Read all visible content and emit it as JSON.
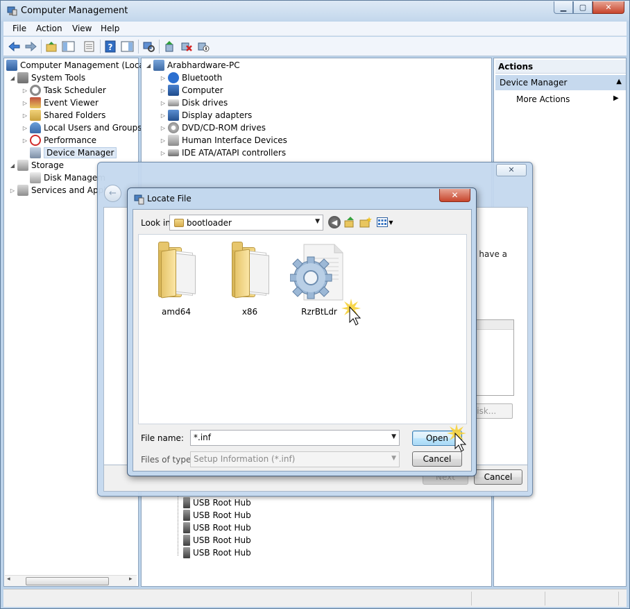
{
  "window": {
    "title": "Computer Management"
  },
  "menu": [
    "File",
    "Action",
    "View",
    "Help"
  ],
  "tree": {
    "root": "Computer Management (Local)",
    "items": [
      {
        "label": "System Tools"
      },
      {
        "label": "Task Scheduler"
      },
      {
        "label": "Event Viewer"
      },
      {
        "label": "Shared Folders"
      },
      {
        "label": "Local Users and Groups"
      },
      {
        "label": "Performance"
      },
      {
        "label": "Device Manager"
      },
      {
        "label": "Storage"
      },
      {
        "label": "Disk Managem"
      },
      {
        "label": "Services and Appl"
      }
    ]
  },
  "devices": {
    "computer": "Arabhardware-PC",
    "categories": [
      "Bluetooth",
      "Computer",
      "Disk drives",
      "Display adapters",
      "DVD/CD-ROM drives",
      "Human Interface Devices",
      "IDE ATA/ATAPI controllers"
    ],
    "usb_hubs": [
      "USB Root Hub",
      "USB Root Hub",
      "USB Root Hub",
      "USB Root Hub",
      "USB Root Hub"
    ]
  },
  "actions": {
    "header": "Actions",
    "section": "Device Manager",
    "more": "More Actions"
  },
  "wizard": {
    "close": "✕",
    "partial_text": "u have a",
    "disk_button": "Disk...",
    "next_button": "Next",
    "cancel_button": "Cancel"
  },
  "locate": {
    "title": "Locate File",
    "look_in_label": "Look in:",
    "look_in_value": "bootloader",
    "files": [
      {
        "name": "amd64",
        "type": "folder"
      },
      {
        "name": "x86",
        "type": "folder"
      },
      {
        "name": "RzrBtLdr",
        "type": "inf"
      }
    ],
    "file_name_label": "File name:",
    "file_name_value": "*.inf",
    "files_of_type_label": "Files of type:",
    "files_of_type_value": "Setup Information (*.inf)",
    "open_button": "Open",
    "cancel_button": "Cancel"
  },
  "colors": {
    "accent": "#3c7fb1",
    "selection": "#dde8f5",
    "window_frame": "#bcd3ea"
  }
}
